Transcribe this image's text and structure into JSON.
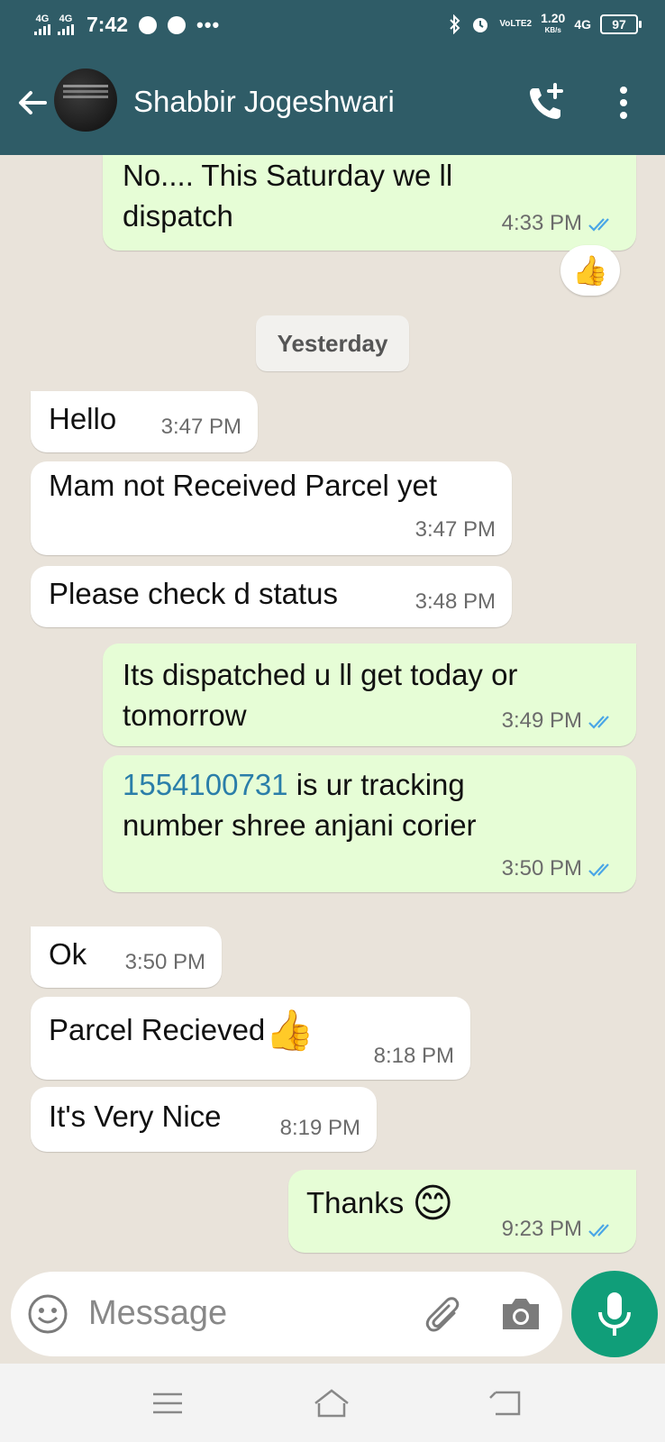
{
  "status_bar": {
    "net1": "4G",
    "net2": "4G",
    "time": "7:42",
    "more": "•••",
    "lte": "VoLTE2",
    "speed": "1.20",
    "speed_unit": "KB/s",
    "net3": "4G",
    "battery": "97"
  },
  "header": {
    "contact_name": "Shabbir Jogeshwari",
    "icons": [
      "back-arrow-icon",
      "add-call-icon",
      "more-vert-icon"
    ]
  },
  "chat": {
    "day_separator": "Yesterday",
    "reaction": "👍",
    "messages": [
      {
        "dir": "out",
        "lines": [
          "No.... This Saturday we ll",
          "dispatch"
        ],
        "time": "4:33 PM",
        "read": true
      },
      {
        "dir": "in",
        "lines": [
          "Hello"
        ],
        "time": "3:47 PM"
      },
      {
        "dir": "in",
        "lines": [
          "Mam not Received Parcel  yet"
        ],
        "time": "3:47 PM"
      },
      {
        "dir": "in",
        "lines": [
          "Please check d status"
        ],
        "time": "3:48 PM"
      },
      {
        "dir": "out",
        "lines": [
          "Its dispatched u ll get today or",
          "tomorrow"
        ],
        "time": "3:49 PM",
        "read": true
      },
      {
        "dir": "out",
        "link": "1554100731",
        "lines": [
          " is ur tracking",
          "number shree anjani corier"
        ],
        "time": "3:50 PM",
        "read": true
      },
      {
        "dir": "in",
        "lines": [
          "Ok"
        ],
        "time": "3:50 PM"
      },
      {
        "dir": "in",
        "lines": [
          "Parcel Recieved"
        ],
        "emoji": "👍",
        "time": "8:18 PM"
      },
      {
        "dir": "in",
        "lines": [
          "It's Very Nice"
        ],
        "time": "8:19 PM"
      },
      {
        "dir": "out",
        "lines": [
          "Thanks "
        ],
        "emoji": "😊",
        "time": "9:23 PM",
        "read": true
      }
    ]
  },
  "composer": {
    "placeholder": "Message",
    "icons": [
      "emoji-icon",
      "attach-icon",
      "camera-icon",
      "mic-icon"
    ]
  },
  "nav_bar": {
    "icons": [
      "menu-icon",
      "home-icon",
      "back-icon"
    ]
  },
  "colors": {
    "header": "#2f5c67",
    "outgoing_bubble": "#e6fdd6",
    "incoming_bubble": "#ffffff",
    "chat_bg": "#e9e3da",
    "mic_button": "#109e79",
    "read_ticks": "#4aa6e6",
    "link": "#2a7ea9"
  }
}
